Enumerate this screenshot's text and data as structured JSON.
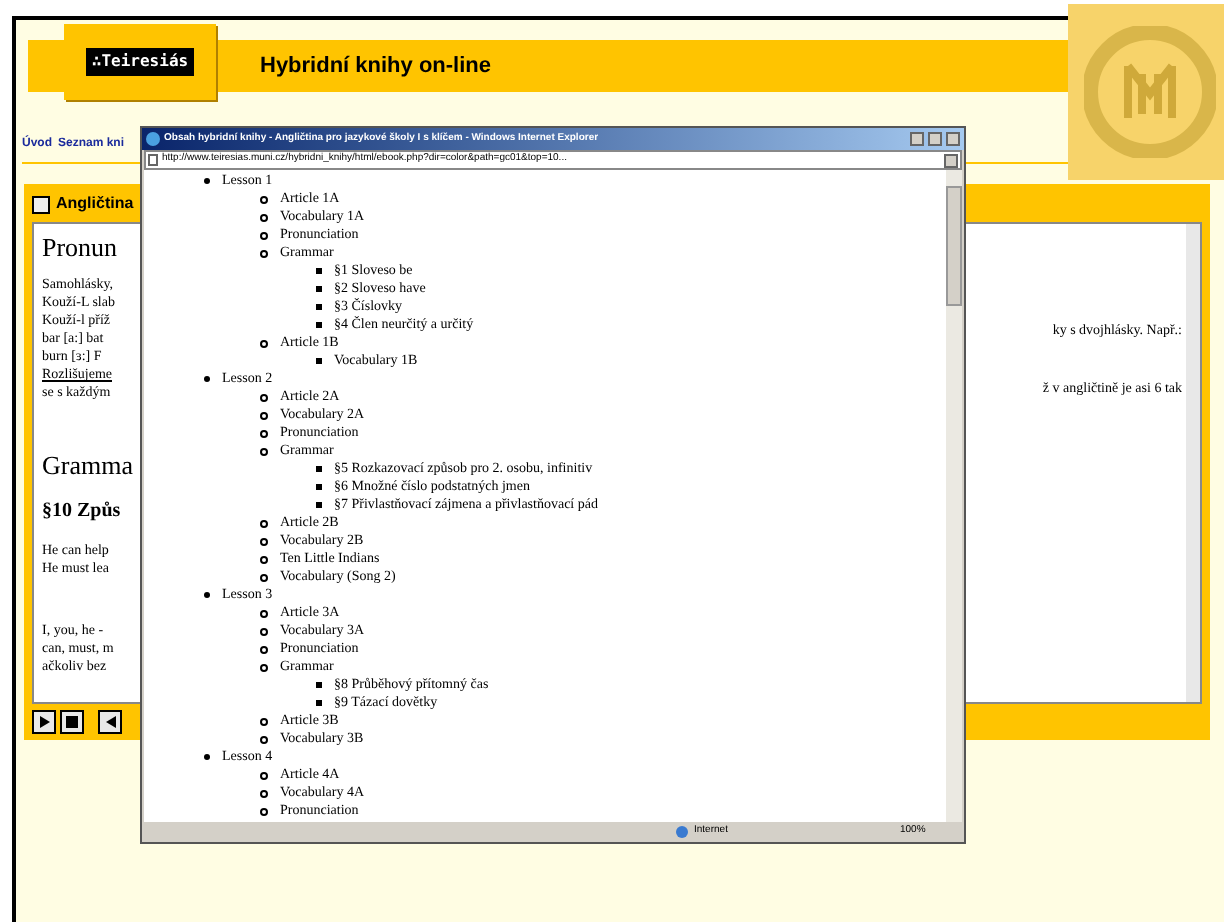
{
  "site": {
    "logo": "∴Teiresiás",
    "title": "Hybridní knihy on-line"
  },
  "nav": [
    {
      "label": "Úvod"
    },
    {
      "label": "Seznam kni"
    }
  ],
  "panel": {
    "title": "Angličtina",
    "left_fragments": [
      {
        "kind": "heading",
        "text": "Pronun"
      },
      {
        "kind": "line",
        "text": "Samohlásky,"
      },
      {
        "kind": "line",
        "text": "Kouží-L slab"
      },
      {
        "kind": "line",
        "text": "Kouží-l příž"
      },
      {
        "kind": "line",
        "text": "bar [a:] bat"
      },
      {
        "kind": "line",
        "text": "burn [ɜ:] F"
      },
      {
        "kind": "link",
        "text": "Rozlišujeme"
      },
      {
        "kind": "line",
        "text": "se s každým"
      },
      {
        "kind": "gap"
      },
      {
        "kind": "heading",
        "text": "Gramma"
      },
      {
        "kind": "subheading",
        "text": "§10 Způs"
      },
      {
        "kind": "line",
        "text": "He can help"
      },
      {
        "kind": "line",
        "text": "He must lea"
      },
      {
        "kind": "gap"
      },
      {
        "kind": "line",
        "text": "I, you, he -"
      },
      {
        "kind": "line",
        "text": "can, must, m"
      },
      {
        "kind": "line",
        "text": "ačkoliv bez"
      }
    ],
    "right_fragments": [
      "ky s dvojhlásky. Např.:",
      "ž v angličtině je asi 6 tak"
    ]
  },
  "popup": {
    "title": "Obsah hybridní knihy - Angličtina pro jazykové školy I s klíčem - Windows Internet Explorer",
    "address": "http://www.teiresias.muni.cz/hybridni_knihy/html/ebook.php?dir=color&path=gc01&top=10...",
    "toc": [
      {
        "label": "Lesson 1",
        "children": [
          {
            "label": "Article 1A"
          },
          {
            "label": "Vocabulary 1A"
          },
          {
            "label": "Pronunciation"
          },
          {
            "label": "Grammar",
            "children": [
              {
                "label": "§1 Sloveso be"
              },
              {
                "label": "§2 Sloveso have"
              },
              {
                "label": "§3 Číslovky"
              },
              {
                "label": "§4 Člen neurčitý a určitý"
              }
            ]
          },
          {
            "label": "Article 1B",
            "children": [
              {
                "label": "Vocabulary 1B"
              }
            ]
          }
        ]
      },
      {
        "label": "Lesson 2",
        "children": [
          {
            "label": "Article 2A"
          },
          {
            "label": "Vocabulary 2A"
          },
          {
            "label": "Pronunciation"
          },
          {
            "label": "Grammar",
            "children": [
              {
                "label": "§5 Rozkazovací způsob pro 2. osobu, infinitiv"
              },
              {
                "label": "§6 Množné číslo podstatných jmen"
              },
              {
                "label": "§7 Přivlastňovací zájmena a přivlastňovací pád"
              }
            ]
          },
          {
            "label": "Article 2B"
          },
          {
            "label": "Vocabulary 2B"
          },
          {
            "label": "Ten Little Indians"
          },
          {
            "label": "Vocabulary (Song 2)"
          }
        ]
      },
      {
        "label": "Lesson 3",
        "children": [
          {
            "label": "Article 3A"
          },
          {
            "label": "Vocabulary 3A"
          },
          {
            "label": "Pronunciation"
          },
          {
            "label": "Grammar",
            "children": [
              {
                "label": "§8 Průběhový přítomný čas"
              },
              {
                "label": "§9 Tázací dovětky"
              }
            ]
          },
          {
            "label": "Article 3B"
          },
          {
            "label": "Vocabulary 3B"
          }
        ]
      },
      {
        "label": "Lesson 4",
        "children": [
          {
            "label": "Article 4A"
          },
          {
            "label": "Vocabulary 4A"
          },
          {
            "label": "Pronunciation"
          }
        ]
      }
    ],
    "status": {
      "zone": "Internet",
      "zoom": "100%"
    }
  }
}
